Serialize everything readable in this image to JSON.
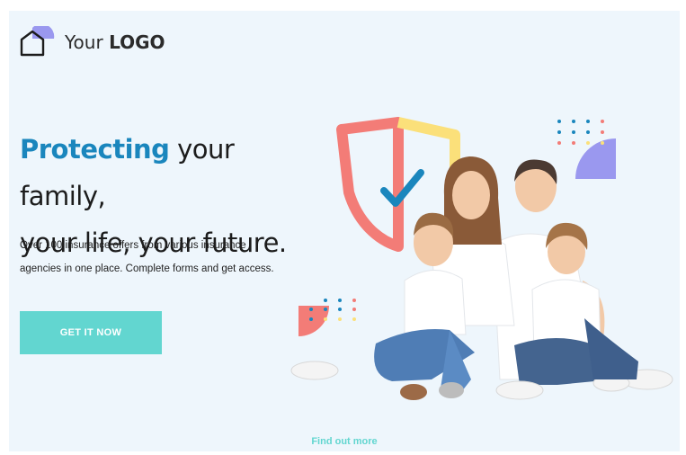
{
  "brand": {
    "logo_word_1": "Your",
    "logo_word_2": "LOGO"
  },
  "hero": {
    "headline_accent": "Protecting",
    "headline_rest_1": " your family,",
    "headline_line_2": "your life, your future.",
    "desc_line_1": "Over 100 insurance offers from various insurance",
    "desc_line_2": "agencies in one place. Complete forms and get access.",
    "cta_label": "GET IT NOW",
    "find_more_label": "Find out more"
  },
  "colors": {
    "accent_blue": "#1a86bd",
    "cta_teal": "#62d6d0",
    "background": "#eef6fc",
    "shield_red": "#f37c77",
    "shield_yellow": "#fbe07a",
    "shape_lilac": "#9a98ef"
  },
  "icons": {
    "logo": "house-icon",
    "shield": "shield-check-icon"
  }
}
